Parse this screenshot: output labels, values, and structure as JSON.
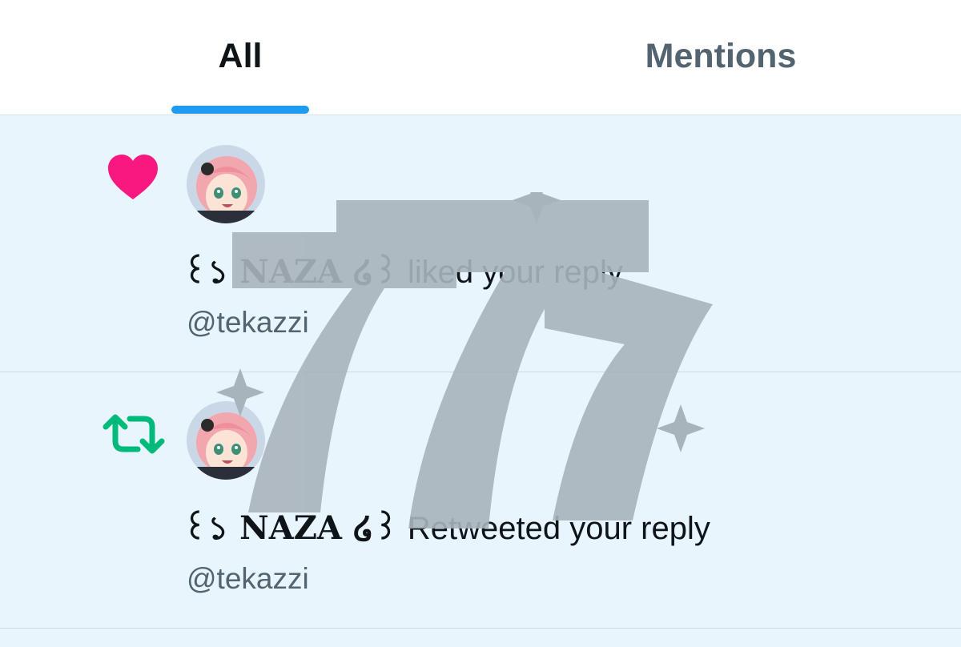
{
  "tabs": [
    {
      "label": "All",
      "active": true
    },
    {
      "label": "Mentions",
      "active": false
    }
  ],
  "notifications": [
    {
      "type": "like",
      "icon": "heart-icon",
      "name": "꒰১ NAZA ໒꒱",
      "action": " liked your reply",
      "handle": "@tekazzi"
    },
    {
      "type": "retweet",
      "icon": "retweet-icon",
      "name": "꒰১ NAZA ໒꒱",
      "action": " Retweeted your reply",
      "handle": "@tekazzi"
    }
  ],
  "colors": {
    "accent": "#1d9bf0",
    "like": "#f91880",
    "retweet": "#00ba7c",
    "unread_bg": "#e8f5fd",
    "text": "#0f1419",
    "muted": "#536471",
    "overlay": "#a8b4bb"
  }
}
